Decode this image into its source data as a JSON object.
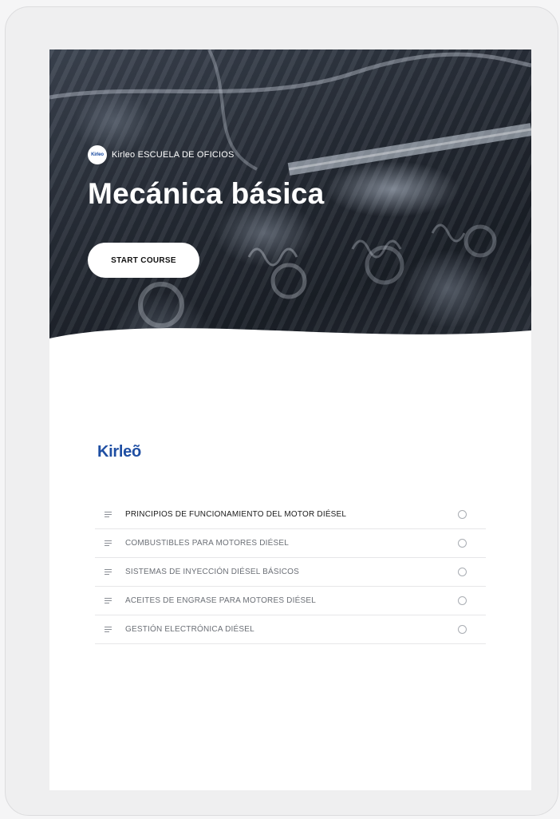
{
  "hero": {
    "brand_badge": "Kirleo",
    "brand_text": "Kirleo ESCUELA DE OFICIOS",
    "title": "Mecánica básica",
    "start_button": "START COURSE"
  },
  "logo": "Kirleõ",
  "lessons": [
    {
      "label": "PRINCIPIOS DE FUNCIONAMIENTO DEL MOTOR DIÉSEL",
      "active": true
    },
    {
      "label": "COMBUSTIBLES PARA MOTORES DIÉSEL",
      "active": false
    },
    {
      "label": "SISTEMAS DE INYECCIÓN DIÉSEL BÁSICOS",
      "active": false
    },
    {
      "label": "ACEITES DE ENGRASE PARA MOTORES DIÉSEL",
      "active": false
    },
    {
      "label": "GESTIÓN ELECTRÓNICA DIÉSEL",
      "active": false
    }
  ],
  "icons": {
    "lesson": "text-lines-icon",
    "status": "empty-circle-icon",
    "brand": "kirleo-badge-icon"
  },
  "colors": {
    "brand_blue": "#1f4fa3",
    "hero_dark": "#262c36",
    "button_bg": "#ffffff"
  }
}
